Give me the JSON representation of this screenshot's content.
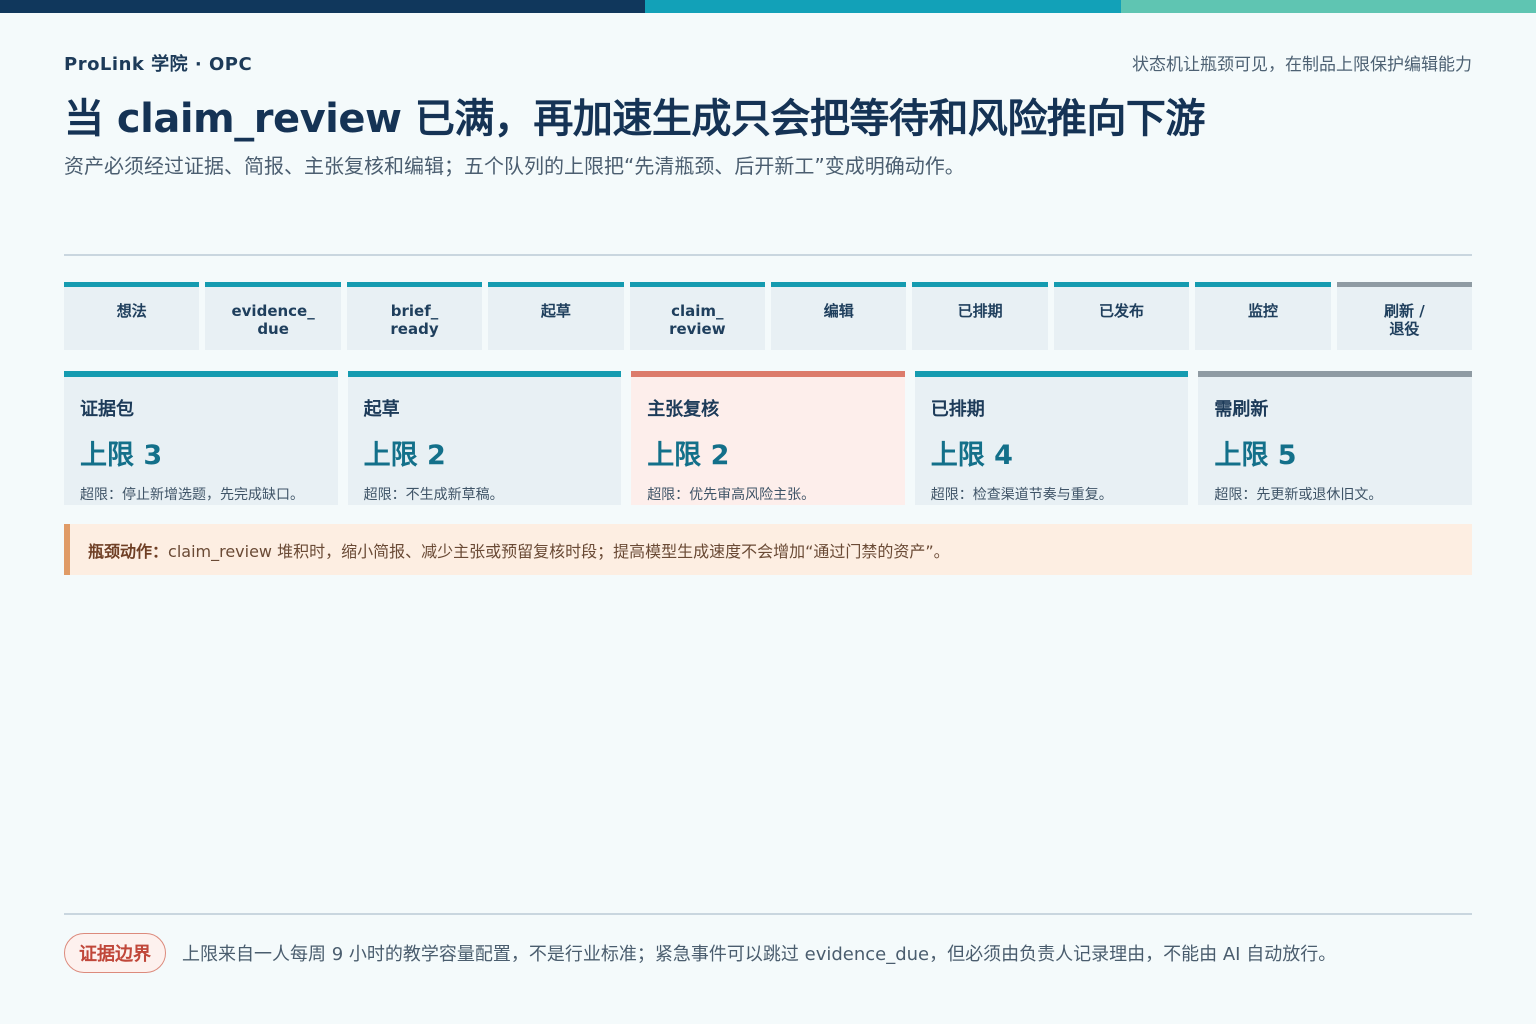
{
  "colors": {
    "top_bar": [
      "#10375c",
      "#12a1b8",
      "#5fc5b2"
    ],
    "stage_accent": "#159bb0",
    "stage_accent_inactive": "#8f9ba3",
    "bottleneck_accent": "#dc7b6b",
    "callout_accent": "#e09b66"
  },
  "header": {
    "brand": "ProLink 学院 · OPC",
    "tagline": "状态机让瓶颈可见，在制品上限保护编辑能力",
    "title": "当 claim_review 已满，再加速生成只会把等待和风险推向下游",
    "subtitle": "资产必须经过证据、简报、主张复核和编辑；五个队列的上限把“先清瓶颈、后开新工”变成明确动作。"
  },
  "stages": [
    {
      "label": "想法",
      "accent": "teal"
    },
    {
      "label": "evidence_\ndue",
      "accent": "teal"
    },
    {
      "label": "brief_\nready",
      "accent": "teal"
    },
    {
      "label": "起草",
      "accent": "teal"
    },
    {
      "label": "claim_\nreview",
      "accent": "teal"
    },
    {
      "label": "编辑",
      "accent": "teal"
    },
    {
      "label": "已排期",
      "accent": "teal"
    },
    {
      "label": "已发布",
      "accent": "teal"
    },
    {
      "label": "监控",
      "accent": "teal"
    },
    {
      "label": "刷新 /\n退役",
      "accent": "gray"
    }
  ],
  "wip_limits": [
    {
      "name": "证据包",
      "limit": "上限 3",
      "note": "超限：停止新增选题，先完成缺口。",
      "state": "normal"
    },
    {
      "name": "起草",
      "limit": "上限 2",
      "note": "超限：不生成新草稿。",
      "state": "normal"
    },
    {
      "name": "主张复核",
      "limit": "上限 2",
      "note": "超限：优先审高风险主张。",
      "state": "bottleneck"
    },
    {
      "name": "已排期",
      "limit": "上限 4",
      "note": "超限：检查渠道节奏与重复。",
      "state": "normal"
    },
    {
      "name": "需刷新",
      "limit": "上限 5",
      "note": "超限：先更新或退休旧文。",
      "state": "gray"
    }
  ],
  "callout": {
    "label": "瓶颈动作：",
    "text": "claim_review 堆积时，缩小简报、减少主张或预留复核时段；提高模型生成速度不会增加“通过门禁的资产”。"
  },
  "footer": {
    "badge": "证据边界",
    "note": "上限来自一人每周 9 小时的教学容量配置，不是行业标准；紧急事件可以跳过 evidence_due，但必须由负责人记录理由，不能由 AI 自动放行。"
  }
}
